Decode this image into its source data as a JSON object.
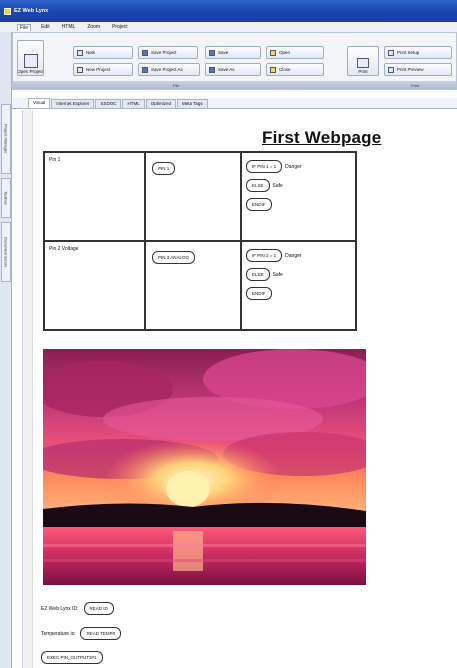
{
  "window": {
    "title": "EZ Web Lynx"
  },
  "menu": {
    "items": [
      "File",
      "Edit",
      "HTML",
      "Zoom",
      "Project"
    ]
  },
  "ribbon": {
    "open_project": "Open Project",
    "new": "New",
    "new_project": "New Project",
    "save_project": "Save Project",
    "save_project_as": "Save Project As",
    "save": "Save",
    "save_as": "Save As",
    "open": "Open",
    "close": "Close",
    "print": "Print",
    "print_setup": "Print Setup",
    "print_preview": "Print Preview",
    "group_file": "File",
    "group_print": "Print"
  },
  "side_tabs": [
    "Project Manager",
    "Toolbox",
    "Document Errors"
  ],
  "doc_tabs": [
    "Visual",
    "Internet Explorer",
    "SSDOC",
    "HTML",
    "Optimized",
    "Meta Tags"
  ],
  "page": {
    "title": "First Webpage",
    "rows": [
      {
        "label": "Pin 1",
        "tag": "PIN 1",
        "if_tag": "IF PIN 1 = 1",
        "if_text": "Danger",
        "else_tag": "ELSE",
        "else_text": "Safe",
        "endif_tag": "ENDIF"
      },
      {
        "label": "Pin 2 Voltage",
        "tag": "PIN 3 ANALOG",
        "if_tag": "IF PIN 2 = 1",
        "if_text": "Danger",
        "else_tag": "ELSE",
        "else_text": "Safe",
        "endif_tag": "ENDIF"
      }
    ],
    "web_lynx_label": "EZ Web Lynx ID:",
    "read_id": "READ ID",
    "temperature_label": "Temperature is:",
    "read_temp": "READ TEMP0",
    "exec_button": "EXEC PIN_OUTPUT3#1"
  },
  "colors": {
    "titlebar": "#1a45b0",
    "accent": "#2e63cc"
  }
}
